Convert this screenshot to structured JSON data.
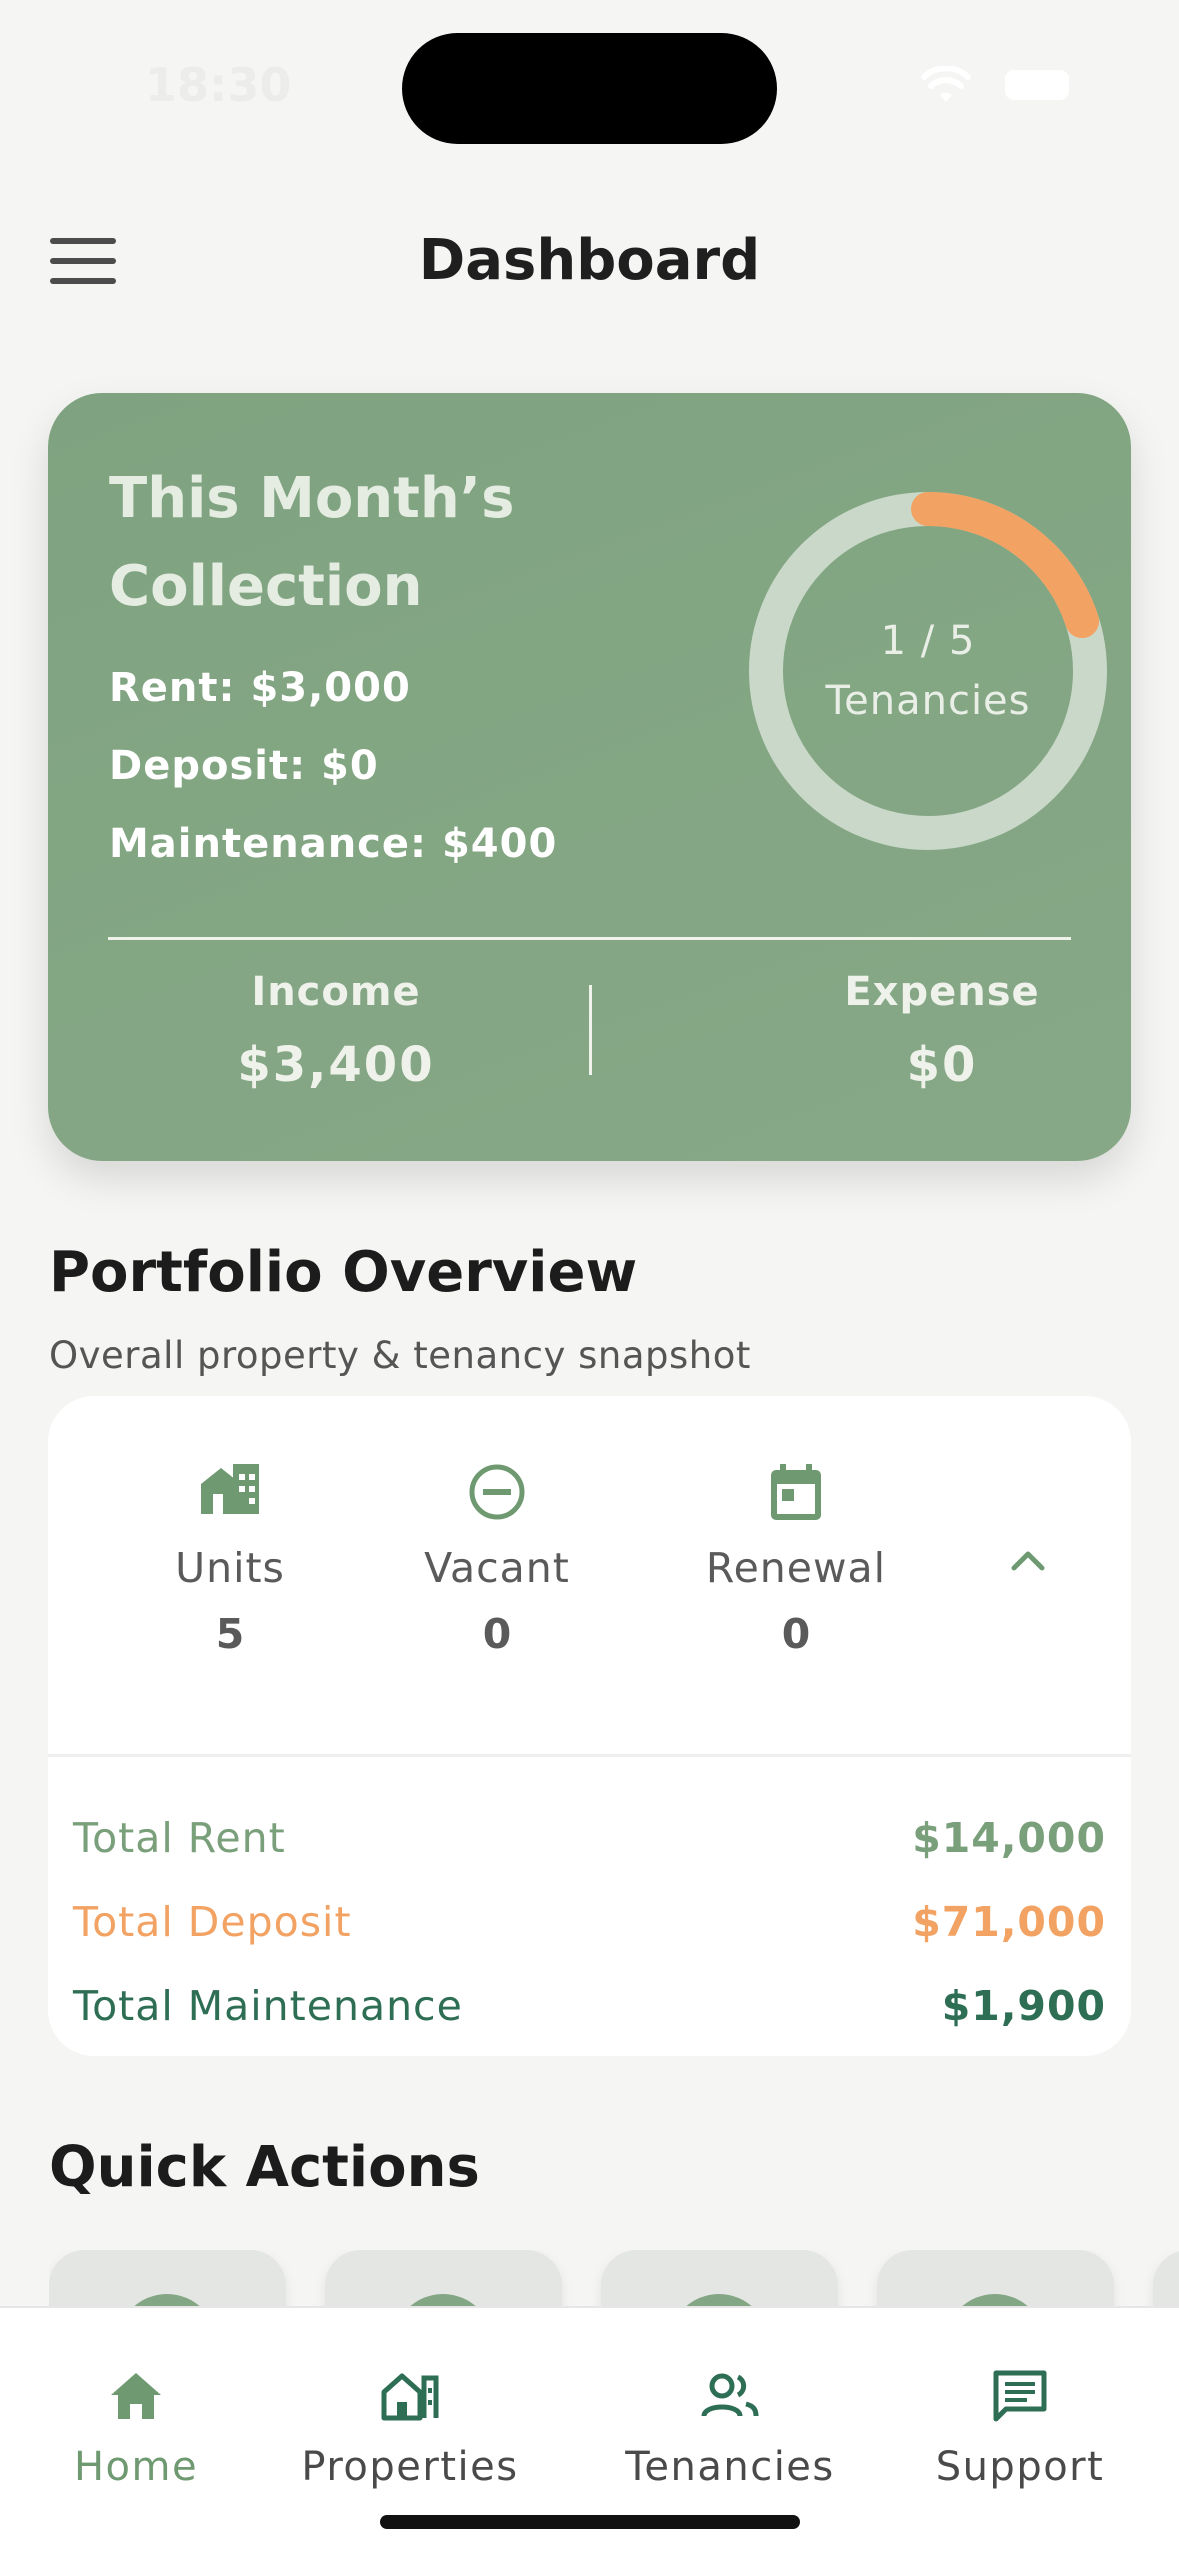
{
  "status_bar": {
    "time": "18:30"
  },
  "header": {
    "title": "Dashboard"
  },
  "collection": {
    "title": "This Month’s Collection",
    "rent": "Rent: $3,000",
    "deposit": "Deposit: $0",
    "maintenance": "Maintenance: $400",
    "ring_count": "1 / 5",
    "ring_label": "Tenancies",
    "ring_progress": 0.2,
    "income_label": "Income",
    "income_value": "$3,400",
    "expense_label": "Expense",
    "expense_value": "$0"
  },
  "portfolio": {
    "title": "Portfolio Overview",
    "subtitle": "Overall property & tenancy snapshot",
    "stats": [
      {
        "label": "Units",
        "value": "5",
        "icon": "building-icon"
      },
      {
        "label": "Vacant",
        "value": "0",
        "icon": "minus-circle-icon"
      },
      {
        "label": "Renewal",
        "value": "0",
        "icon": "calendar-icon"
      }
    ],
    "totals": [
      {
        "label": "Total Rent",
        "value": "$14,000"
      },
      {
        "label": "Total Deposit",
        "value": "$71,000"
      },
      {
        "label": "Total Maintenance",
        "value": "$1,900"
      }
    ]
  },
  "quick_actions": {
    "title": "Quick Actions"
  },
  "nav": [
    {
      "label": "Home",
      "icon": "home-icon"
    },
    {
      "label": "Properties",
      "icon": "properties-icon"
    },
    {
      "label": "Tenancies",
      "icon": "people-icon"
    },
    {
      "label": "Support",
      "icon": "chat-icon"
    }
  ],
  "colors": {
    "brand_green": "#83a684",
    "accent_orange": "#f2a262",
    "dark_green": "#2e6e55",
    "muted_green": "#7a9f7b"
  }
}
